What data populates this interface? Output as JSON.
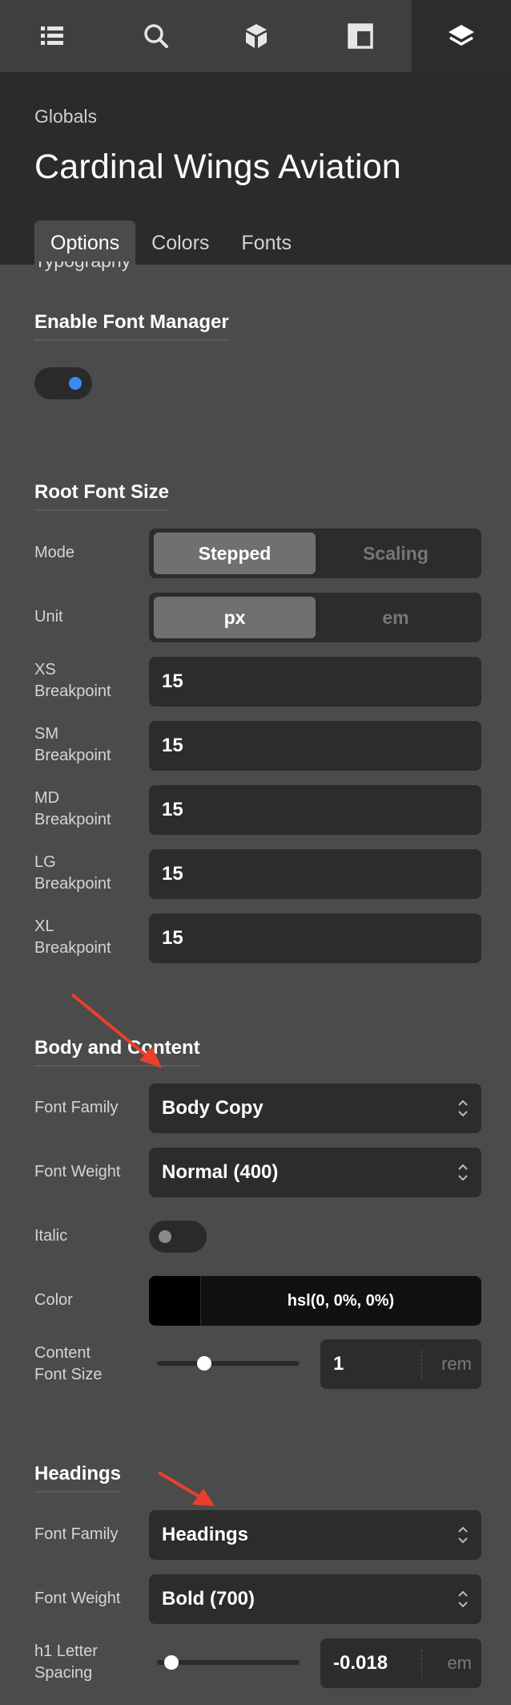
{
  "toolbar": {
    "icons": [
      "list-icon",
      "search-icon",
      "cube-icon",
      "layout-icon",
      "layers-icon"
    ],
    "active": "layers-icon"
  },
  "header": {
    "eyebrow": "Globals",
    "title": "Cardinal Wings Aviation",
    "tabs": [
      "Options",
      "Colors",
      "Fonts"
    ],
    "active_tab": "Options",
    "partial_heading": "Typography"
  },
  "font_manager": {
    "heading": "Enable Font Manager",
    "enabled": true
  },
  "root_font": {
    "heading": "Root Font Size",
    "mode_label": "Mode",
    "mode_options": [
      "Stepped",
      "Scaling"
    ],
    "mode_selected": "Stepped",
    "unit_label": "Unit",
    "unit_options": [
      "px",
      "em"
    ],
    "unit_selected": "px",
    "breakpoints": [
      {
        "label_line1": "XS",
        "label_line2": "Breakpoint",
        "value": "15"
      },
      {
        "label_line1": "SM",
        "label_line2": "Breakpoint",
        "value": "15"
      },
      {
        "label_line1": "MD",
        "label_line2": "Breakpoint",
        "value": "15"
      },
      {
        "label_line1": "LG",
        "label_line2": "Breakpoint",
        "value": "15"
      },
      {
        "label_line1": "XL",
        "label_line2": "Breakpoint",
        "value": "15"
      }
    ]
  },
  "body_content": {
    "heading": "Body and Content",
    "font_family_label": "Font Family",
    "font_family": "Body Copy",
    "font_weight_label": "Font Weight",
    "font_weight": "Normal (400)",
    "italic_label": "Italic",
    "italic_enabled": false,
    "color_label": "Color",
    "color_value": "hsl(0, 0%, 0%)",
    "content_size_label_line1": "Content",
    "content_size_label_line2": "Font Size",
    "content_size_value": "1",
    "content_size_unit": "rem",
    "content_size_slider_fraction": 0.33
  },
  "headings": {
    "heading": "Headings",
    "font_family_label": "Font Family",
    "font_family": "Headings",
    "font_weight_label": "Font Weight",
    "font_weight": "Bold (700)",
    "h1_spacing_label_line1": "h1 Letter",
    "h1_spacing_label_line2": "Spacing",
    "h1_spacing_value": "-0.018",
    "h1_spacing_unit": "em",
    "h1_spacing_slider_fraction": 0.1
  },
  "colors": {
    "panel_bg": "#4b4b4b",
    "header_bg": "#2b2b2b",
    "toggle_on": "#3d8af7",
    "toggle_off": "#8a8a8a",
    "annotation_arrow": "#e9402b"
  }
}
